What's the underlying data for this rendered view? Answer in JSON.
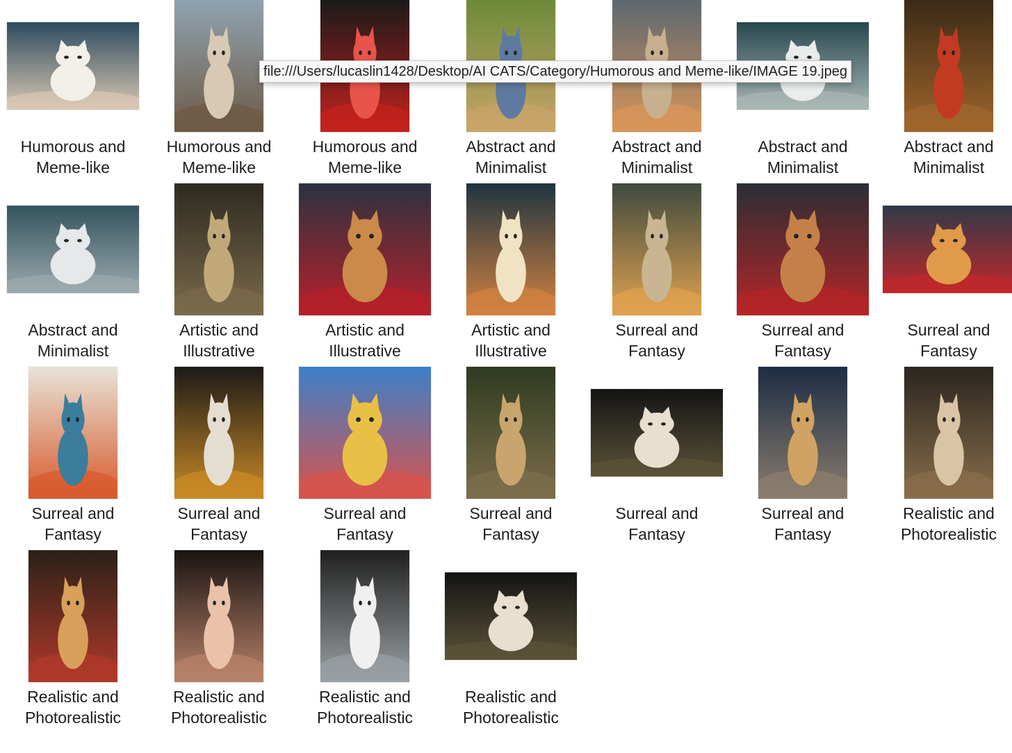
{
  "tooltip": {
    "text": "file:///Users/lucaslin1428/Desktop/AI CATS/Category/Humorous and Meme-like/IMAGE 19.jpeg"
  },
  "items": [
    {
      "line1": "Humorous and",
      "line2": "Meme-like",
      "shape": "wide",
      "scene": "winged-cat-clouds",
      "colors": [
        "#2c4b5e",
        "#d9c7b3",
        "#f3efe9"
      ]
    },
    {
      "line1": "Humorous and",
      "line2": "Meme-like",
      "shape": "tall",
      "scene": "two-cats-balcony",
      "colors": [
        "#8fa3b0",
        "#6e5a45",
        "#d8c9b4"
      ]
    },
    {
      "line1": "Humorous and",
      "line2": "Meme-like",
      "shape": "tall",
      "scene": "strawberry-cat",
      "colors": [
        "#1a1a1a",
        "#c4221c",
        "#e8544a"
      ]
    },
    {
      "line1": "Abstract and",
      "line2": "Minimalist",
      "shape": "tall",
      "scene": "cat-in-field",
      "colors": [
        "#6d8a3a",
        "#c9a46a",
        "#5f7aa0"
      ]
    },
    {
      "line1": "Abstract and",
      "line2": "Minimalist",
      "shape": "tall",
      "scene": "kitten-with-sign",
      "colors": [
        "#5d6870",
        "#d9955a",
        "#c7b08f"
      ]
    },
    {
      "line1": "Abstract and",
      "line2": "Minimalist",
      "shape": "wide",
      "scene": "winged-cat-teal",
      "colors": [
        "#27474f",
        "#a9b7b4",
        "#e8ecea"
      ]
    },
    {
      "line1": "Abstract and",
      "line2": "Minimalist",
      "shape": "tall",
      "scene": "ladybug-cats",
      "colors": [
        "#3b2a17",
        "#a0672c",
        "#c33a22"
      ]
    },
    {
      "line1": "Abstract and",
      "line2": "Minimalist",
      "shape": "wide",
      "scene": "winged-grey-cat",
      "colors": [
        "#34545e",
        "#9aa9ad",
        "#e6e9ea"
      ]
    },
    {
      "line1": "Artistic and",
      "line2": "Illustrative",
      "shape": "tall",
      "scene": "tabby-closeup",
      "colors": [
        "#2d2a1f",
        "#7b6a4c",
        "#c0a878"
      ]
    },
    {
      "line1": "Artistic and",
      "line2": "Illustrative",
      "shape": "sq",
      "scene": "fish-stall",
      "colors": [
        "#2b3340",
        "#b7202a",
        "#c98a4a"
      ]
    },
    {
      "line1": "Artistic and",
      "line2": "Illustrative",
      "shape": "tall",
      "scene": "flux-poster",
      "colors": [
        "#1f3540",
        "#d38240",
        "#f0e3c4"
      ]
    },
    {
      "line1": "Surreal and",
      "line2": "Fantasy",
      "shape": "tall",
      "scene": "buzz-tuna",
      "colors": [
        "#3f4a3f",
        "#e0a24f",
        "#c9b591"
      ]
    },
    {
      "line1": "Surreal and",
      "line2": "Fantasy",
      "shape": "sq",
      "scene": "fish-stall-2",
      "colors": [
        "#2a2e35",
        "#b52527",
        "#c58048"
      ]
    },
    {
      "line1": "Surreal and",
      "line2": "Fantasy",
      "shape": "wide",
      "scene": "fish-buzz-market",
      "colors": [
        "#2f3a48",
        "#c0282b",
        "#e09a4a"
      ]
    },
    {
      "line1": "Surreal and",
      "line2": "Fantasy",
      "shape": "tall",
      "scene": "paint-wall-cat",
      "colors": [
        "#e8e3d8",
        "#d75a2c",
        "#3a7d9c"
      ]
    },
    {
      "line1": "Surreal and",
      "line2": "Fantasy",
      "shape": "tall",
      "scene": "sweater-cat",
      "colors": [
        "#1c1a18",
        "#c98a25",
        "#e4ddd2"
      ]
    },
    {
      "line1": "Surreal and",
      "line2": "Fantasy",
      "shape": "sq",
      "scene": "playground-kitten",
      "colors": [
        "#3c80c9",
        "#d9534a",
        "#e8c046"
      ]
    },
    {
      "line1": "Surreal and",
      "line2": "Fantasy",
      "shape": "tall",
      "scene": "path-cat",
      "colors": [
        "#2f3b20",
        "#7c6d4c",
        "#c9a56e"
      ]
    },
    {
      "line1": "Surreal and",
      "line2": "Fantasy",
      "shape": "wide",
      "scene": "winged-cat-dark",
      "colors": [
        "#141414",
        "#5a5238",
        "#e8dfcf"
      ]
    },
    {
      "line1": "Surreal and",
      "line2": "Fantasy",
      "shape": "tall",
      "scene": "night-tabby",
      "colors": [
        "#1d2d44",
        "#8a7d6e",
        "#d0a362"
      ]
    },
    {
      "line1": "Realistic and",
      "line2": "Photorealistic",
      "shape": "tall",
      "scene": "spider-cats-bed",
      "colors": [
        "#2a261f",
        "#8a6e4c",
        "#d9c4a5"
      ]
    },
    {
      "line1": "Realistic and",
      "line2": "Photorealistic",
      "shape": "tall",
      "scene": "red-buze-poster",
      "colors": [
        "#2b2117",
        "#b0392a",
        "#d8a05a"
      ]
    },
    {
      "line1": "Realistic and",
      "line2": "Photorealistic",
      "shape": "tall",
      "scene": "girl-and-cat",
      "colors": [
        "#1a1412",
        "#b8826a",
        "#e9c2a9"
      ]
    },
    {
      "line1": "Realistic and",
      "line2": "Photorealistic",
      "shape": "tall",
      "scene": "bathtub-cat",
      "colors": [
        "#202020",
        "#9aa0a4",
        "#f0f0f0"
      ]
    },
    {
      "line1": "Realistic and",
      "line2": "Photorealistic",
      "shape": "wide",
      "scene": "winged-cat-dark-2",
      "colors": [
        "#141414",
        "#5a5238",
        "#e8dfcf"
      ]
    }
  ]
}
